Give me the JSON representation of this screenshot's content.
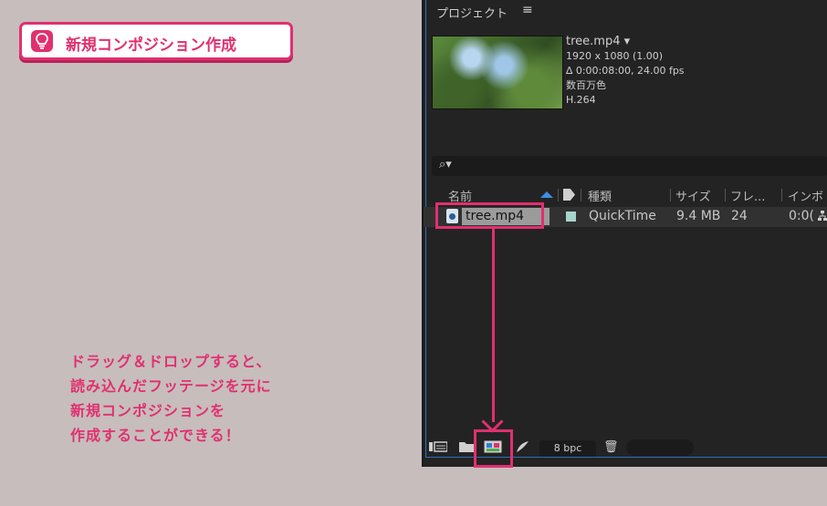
{
  "tip": {
    "icon": "lightbulb-icon",
    "label": "新規コンポジション作成"
  },
  "note": {
    "lines": [
      "ドラッグ＆ドロップすると、",
      "読み込んだフッテージを元に",
      "新規コンポジションを",
      "作成することができる！"
    ]
  },
  "panel": {
    "title": "プロジェクト",
    "menu_icon": "≡",
    "file": {
      "name": "tree.mp4 ▾",
      "resolution": "1920 x 1080 (1.00)",
      "duration": "∆ 0:00:08:00, 24.00 fps",
      "colors": "数百万色",
      "codec": "H.264"
    },
    "search_icon": "⌕▾",
    "columns": {
      "name": "名前",
      "type": "種類",
      "size": "サイズ",
      "frame": "フレ...",
      "in": "インボ"
    },
    "row": {
      "name": "tree.mp4",
      "type": "QuickTime",
      "size": "9.4 MB",
      "frame": "24",
      "in": "0:0("
    },
    "toolbar": {
      "bpc": "8 bpc",
      "trash": "🗑"
    }
  },
  "colors": {
    "accent": "#e0306f",
    "panel_bg": "#232323",
    "page_bg": "#c7bdbd"
  }
}
